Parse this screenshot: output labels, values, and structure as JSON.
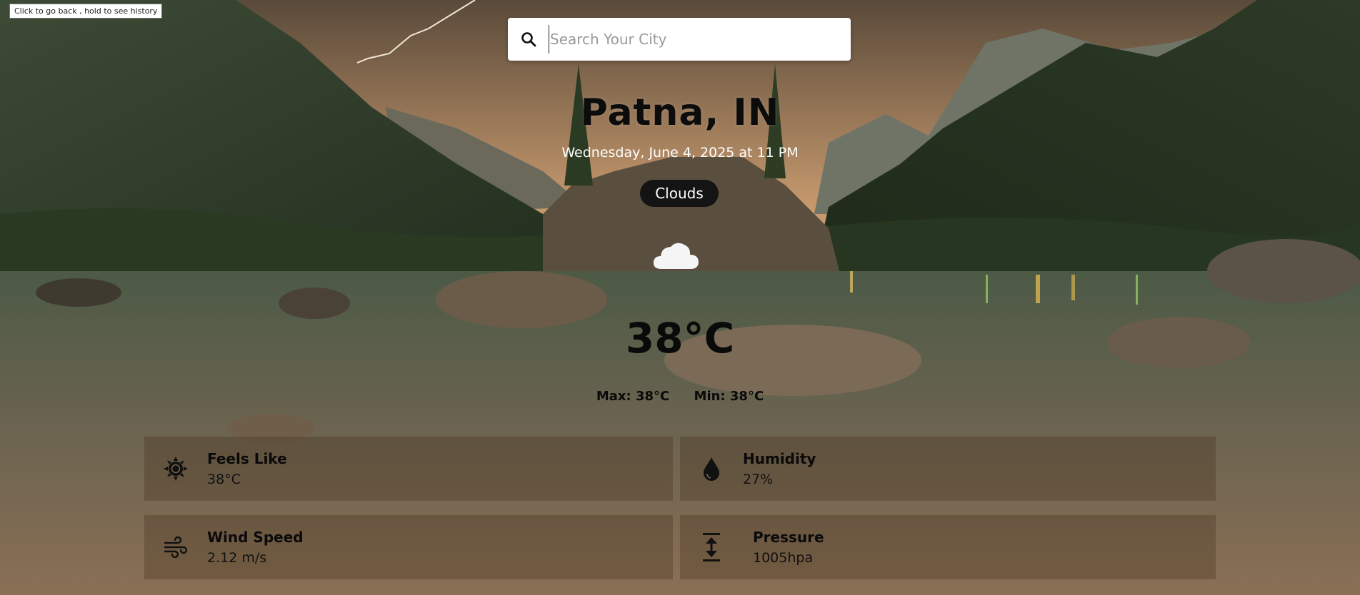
{
  "tooltip": "Click to go back , hold to see history",
  "search": {
    "placeholder": "Search Your City",
    "value": ""
  },
  "location": "Patna, IN",
  "datetime": "Wednesday, June 4, 2025 at 11 PM",
  "condition": "Clouds",
  "temperature": "38°C",
  "max": "Max: 38°C",
  "min": "Min: 38°C",
  "cards": [
    {
      "label": "Feels Like",
      "value": "38°C",
      "icon": "sun-icon"
    },
    {
      "label": "Humidity",
      "value": "27%",
      "icon": "water-drop-icon"
    },
    {
      "label": "Wind Speed",
      "value": "2.12 m/s",
      "icon": "wind-icon"
    },
    {
      "label": "Pressure",
      "value": "1005hpa",
      "icon": "pressure-icon"
    }
  ],
  "colors": {
    "pill": "#141414",
    "search_bg": "#ffffff",
    "text_dark": "#0a0a0a",
    "text_light": "#ffffff"
  }
}
